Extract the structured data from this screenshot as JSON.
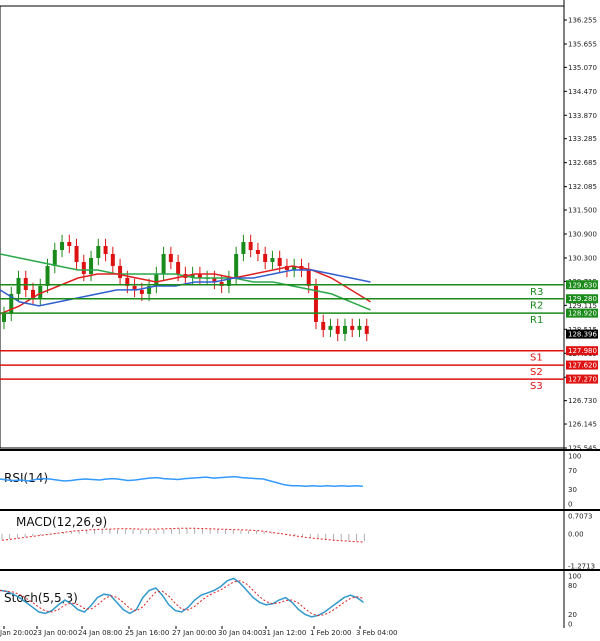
{
  "price_axis": {
    "labels": [
      "136.255",
      "135.655",
      "135.070",
      "134.470",
      "133.870",
      "133.285",
      "132.685",
      "132.085",
      "131.500",
      "130.900",
      "130.300",
      "129.715",
      "129.115",
      "128.515",
      "127.915",
      "127.315",
      "126.730",
      "126.145",
      "125.545"
    ],
    "min": 125.545,
    "max": 136.255
  },
  "levels": [
    {
      "name": "R3",
      "value": 129.63,
      "tag": "129.630",
      "color": "#1a8a1a"
    },
    {
      "name": "R2",
      "value": 129.28,
      "tag": "129.280",
      "color": "#1a8a1a"
    },
    {
      "name": "R1",
      "value": 128.92,
      "tag": "128.920",
      "color": "#1a8a1a"
    },
    {
      "name": "S1",
      "value": 127.98,
      "tag": "127.980",
      "color": "#dd1111"
    },
    {
      "name": "S2",
      "value": 127.62,
      "tag": "127.620",
      "color": "#dd1111"
    },
    {
      "name": "S3",
      "value": 127.27,
      "tag": "127.270",
      "color": "#dd1111"
    }
  ],
  "current_price": {
    "tag": "128.396",
    "value": 128.396
  },
  "rsi": {
    "title": "RSI(14)",
    "axis": [
      "100",
      "70",
      "30",
      "0"
    ],
    "values": [
      52,
      50,
      49,
      50,
      48,
      51,
      53,
      52,
      50,
      48,
      49,
      51,
      52,
      51,
      50,
      52,
      53,
      51,
      49,
      50,
      52,
      54,
      55,
      53,
      52,
      51,
      53,
      54,
      55,
      56,
      54,
      55,
      56,
      57,
      55,
      54,
      53,
      52,
      48,
      44,
      40,
      38,
      38,
      37,
      38,
      37,
      38,
      37,
      38,
      37,
      38,
      37
    ]
  },
  "macd": {
    "title": "MACD(12,26,9)",
    "axis": [
      "0.7073",
      "0.00",
      "-1.2713"
    ],
    "signal": [
      -0.25,
      -0.22,
      -0.18,
      -0.14,
      -0.1,
      -0.06,
      -0.02,
      0.02,
      0.06,
      0.1,
      0.13,
      0.15,
      0.17,
      0.18,
      0.19,
      0.2,
      0.2,
      0.2,
      0.19,
      0.19,
      0.19,
      0.2,
      0.21,
      0.22,
      0.22,
      0.22,
      0.21,
      0.2,
      0.19,
      0.18,
      0.17,
      0.16,
      0.15,
      0.13,
      0.1,
      0.06,
      0.02,
      -0.03,
      -0.08,
      -0.12,
      -0.16,
      -0.19,
      -0.22,
      -0.25,
      -0.27,
      -0.29,
      -0.31,
      -0.32
    ]
  },
  "stoch": {
    "title": "Stoch(5,5,3)",
    "axis": [
      "100",
      "80",
      "20",
      "0"
    ],
    "k": [
      70,
      68,
      62,
      55,
      45,
      35,
      25,
      22,
      28,
      40,
      50,
      42,
      30,
      25,
      38,
      55,
      62,
      60,
      45,
      30,
      22,
      30,
      55,
      70,
      75,
      60,
      40,
      28,
      25,
      35,
      50,
      60,
      65,
      70,
      78,
      90,
      95,
      85,
      70,
      55,
      45,
      40,
      42,
      50,
      55,
      45,
      30,
      20,
      15,
      18,
      25,
      35,
      45,
      55,
      60,
      55,
      45
    ]
  },
  "time_axis": [
    "Jan 20:00",
    "23 Jan 00:00",
    "24 Jan 08:00",
    "25 Jan 16:00",
    "27 Jan 00:00",
    "30 Jan 04:00",
    "31 Jan 12:00",
    "1 Feb 20:00",
    "3 Feb 04:00"
  ],
  "colors": {
    "bull": "#1a8a1a",
    "bear": "#dd1111",
    "ma_green": "#2aa84a",
    "ma_red": "#e02020",
    "ma_blue": "#3060d0",
    "rsi": "#3399ff",
    "macd_signal": "#dd2222"
  }
}
